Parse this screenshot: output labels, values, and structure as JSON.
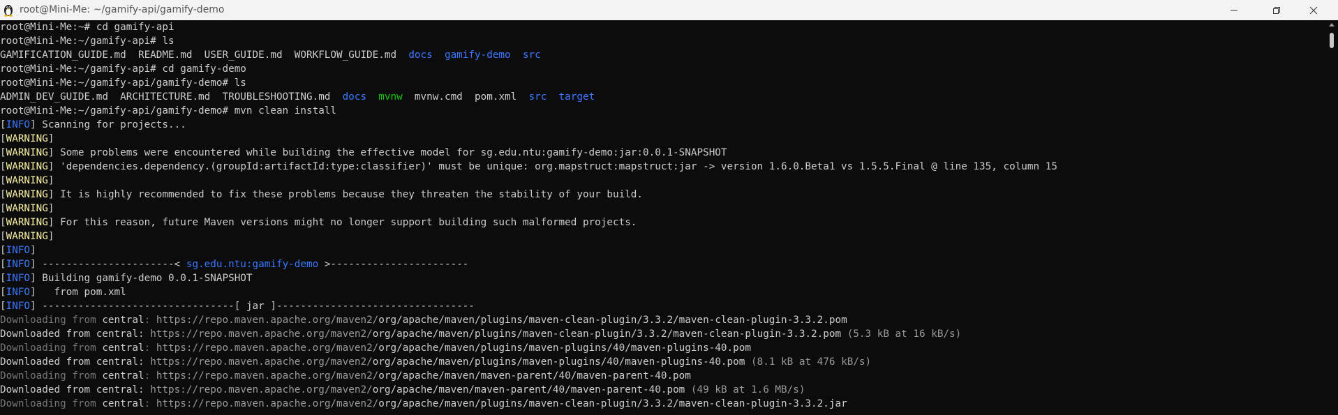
{
  "window": {
    "title": "root@Mini-Me: ~/gamify-api/gamify-demo"
  },
  "lines": [
    {
      "segments": [
        {
          "t": "root@Mini-Me:~# cd gamify-api",
          "c": ""
        }
      ]
    },
    {
      "segments": [
        {
          "t": "root@Mini-Me:~/gamify-api# ls",
          "c": ""
        }
      ]
    },
    {
      "segments": [
        {
          "t": "GAMIFICATION_GUIDE.md  README.md  USER_GUIDE.md  WORKFLOW_GUIDE.md  ",
          "c": ""
        },
        {
          "t": "docs",
          "c": "c-blue"
        },
        {
          "t": "  ",
          "c": ""
        },
        {
          "t": "gamify-demo",
          "c": "c-blue"
        },
        {
          "t": "  ",
          "c": ""
        },
        {
          "t": "src",
          "c": "c-blue"
        }
      ]
    },
    {
      "segments": [
        {
          "t": "root@Mini-Me:~/gamify-api# cd gamify-demo",
          "c": ""
        }
      ]
    },
    {
      "segments": [
        {
          "t": "root@Mini-Me:~/gamify-api/gamify-demo# ls",
          "c": ""
        }
      ]
    },
    {
      "segments": [
        {
          "t": "ADMIN_DEV_GUIDE.md  ARCHITECTURE.md  TROUBLESHOOTING.md  ",
          "c": ""
        },
        {
          "t": "docs",
          "c": "c-blue"
        },
        {
          "t": "  ",
          "c": ""
        },
        {
          "t": "mvnw",
          "c": "c-green"
        },
        {
          "t": "  mvnw.cmd  pom.xml  ",
          "c": ""
        },
        {
          "t": "src",
          "c": "c-blue"
        },
        {
          "t": "  ",
          "c": ""
        },
        {
          "t": "target",
          "c": "c-blue"
        }
      ]
    },
    {
      "segments": [
        {
          "t": "root@Mini-Me:~/gamify-api/gamify-demo# mvn clean install",
          "c": ""
        }
      ]
    },
    {
      "segments": [
        {
          "t": "[",
          "c": ""
        },
        {
          "t": "INFO",
          "c": "c-blue"
        },
        {
          "t": "] Scanning for projects...",
          "c": ""
        }
      ]
    },
    {
      "segments": [
        {
          "t": "[",
          "c": ""
        },
        {
          "t": "WARNING",
          "c": "c-yellow"
        },
        {
          "t": "]",
          "c": ""
        }
      ]
    },
    {
      "segments": [
        {
          "t": "[",
          "c": ""
        },
        {
          "t": "WARNING",
          "c": "c-yellow"
        },
        {
          "t": "] Some problems were encountered while building the effective model for sg.edu.ntu:gamify-demo:jar:0.0.1-SNAPSHOT",
          "c": ""
        }
      ]
    },
    {
      "segments": [
        {
          "t": "[",
          "c": ""
        },
        {
          "t": "WARNING",
          "c": "c-yellow"
        },
        {
          "t": "] 'dependencies.dependency.(groupId:artifactId:type:classifier)' must be unique: org.mapstruct:mapstruct:jar -> version 1.6.0.Beta1 vs 1.5.5.Final @ line 135, column 15",
          "c": ""
        }
      ]
    },
    {
      "segments": [
        {
          "t": "[",
          "c": ""
        },
        {
          "t": "WARNING",
          "c": "c-yellow"
        },
        {
          "t": "]",
          "c": ""
        }
      ]
    },
    {
      "segments": [
        {
          "t": "[",
          "c": ""
        },
        {
          "t": "WARNING",
          "c": "c-yellow"
        },
        {
          "t": "] It is highly recommended to fix these problems because they threaten the stability of your build.",
          "c": ""
        }
      ]
    },
    {
      "segments": [
        {
          "t": "[",
          "c": ""
        },
        {
          "t": "WARNING",
          "c": "c-yellow"
        },
        {
          "t": "]",
          "c": ""
        }
      ]
    },
    {
      "segments": [
        {
          "t": "[",
          "c": ""
        },
        {
          "t": "WARNING",
          "c": "c-yellow"
        },
        {
          "t": "] For this reason, future Maven versions might no longer support building such malformed projects.",
          "c": ""
        }
      ]
    },
    {
      "segments": [
        {
          "t": "[",
          "c": ""
        },
        {
          "t": "WARNING",
          "c": "c-yellow"
        },
        {
          "t": "]",
          "c": ""
        }
      ]
    },
    {
      "segments": [
        {
          "t": "[",
          "c": ""
        },
        {
          "t": "INFO",
          "c": "c-blue"
        },
        {
          "t": "]",
          "c": ""
        }
      ]
    },
    {
      "segments": [
        {
          "t": "[",
          "c": ""
        },
        {
          "t": "INFO",
          "c": "c-blue"
        },
        {
          "t": "] ----------------------< ",
          "c": ""
        },
        {
          "t": "sg.edu.ntu:gamify-demo",
          "c": "c-blue"
        },
        {
          "t": " >-----------------------",
          "c": ""
        }
      ]
    },
    {
      "segments": [
        {
          "t": "[",
          "c": ""
        },
        {
          "t": "INFO",
          "c": "c-blue"
        },
        {
          "t": "] Building gamify-demo 0.0.1-SNAPSHOT",
          "c": ""
        }
      ]
    },
    {
      "segments": [
        {
          "t": "[",
          "c": ""
        },
        {
          "t": "INFO",
          "c": "c-blue"
        },
        {
          "t": "]   from pom.xml",
          "c": ""
        }
      ]
    },
    {
      "segments": [
        {
          "t": "[",
          "c": ""
        },
        {
          "t": "INFO",
          "c": "c-blue"
        },
        {
          "t": "] --------------------------------[ jar ]---------------------------------",
          "c": ""
        }
      ]
    },
    {
      "segments": [
        {
          "t": "Downloading from ",
          "c": "c-gray"
        },
        {
          "t": "central",
          "c": ""
        },
        {
          "t": ": ",
          "c": "c-gray"
        },
        {
          "t": "https://repo.maven.apache.org/maven2/",
          "c": "c-url"
        },
        {
          "t": "org/apache/maven/plugins/maven-clean-plugin/3.3.2/maven-clean-plugin-3.3.2.pom",
          "c": ""
        }
      ]
    },
    {
      "segments": [
        {
          "t": "Downloaded from ",
          "c": ""
        },
        {
          "t": "central",
          "c": ""
        },
        {
          "t": ": ",
          "c": ""
        },
        {
          "t": "https://repo.maven.apache.org/maven2/",
          "c": "c-url"
        },
        {
          "t": "org/apache/maven/plugins/maven-clean-plugin/3.3.2/maven-clean-plugin-3.3.2.pom",
          "c": ""
        },
        {
          "t": " (5.3 kB at 16 kB/s)",
          "c": "c-url"
        }
      ]
    },
    {
      "segments": [
        {
          "t": "Downloading from ",
          "c": "c-gray"
        },
        {
          "t": "central",
          "c": ""
        },
        {
          "t": ": ",
          "c": "c-gray"
        },
        {
          "t": "https://repo.maven.apache.org/maven2/",
          "c": "c-url"
        },
        {
          "t": "org/apache/maven/plugins/maven-plugins/40/maven-plugins-40.pom",
          "c": ""
        }
      ]
    },
    {
      "segments": [
        {
          "t": "Downloaded from ",
          "c": ""
        },
        {
          "t": "central",
          "c": ""
        },
        {
          "t": ": ",
          "c": ""
        },
        {
          "t": "https://repo.maven.apache.org/maven2/",
          "c": "c-url"
        },
        {
          "t": "org/apache/maven/plugins/maven-plugins/40/maven-plugins-40.pom",
          "c": ""
        },
        {
          "t": " (8.1 kB at 476 kB/s)",
          "c": "c-url"
        }
      ]
    },
    {
      "segments": [
        {
          "t": "Downloading from ",
          "c": "c-gray"
        },
        {
          "t": "central",
          "c": ""
        },
        {
          "t": ": ",
          "c": "c-gray"
        },
        {
          "t": "https://repo.maven.apache.org/maven2/",
          "c": "c-url"
        },
        {
          "t": "org/apache/maven/maven-parent/40/maven-parent-40.pom",
          "c": ""
        }
      ]
    },
    {
      "segments": [
        {
          "t": "Downloaded from ",
          "c": ""
        },
        {
          "t": "central",
          "c": ""
        },
        {
          "t": ": ",
          "c": ""
        },
        {
          "t": "https://repo.maven.apache.org/maven2/",
          "c": "c-url"
        },
        {
          "t": "org/apache/maven/maven-parent/40/maven-parent-40.pom",
          "c": ""
        },
        {
          "t": " (49 kB at 1.6 MB/s)",
          "c": "c-url"
        }
      ]
    },
    {
      "segments": [
        {
          "t": "Downloading from ",
          "c": "c-gray"
        },
        {
          "t": "central",
          "c": ""
        },
        {
          "t": ": ",
          "c": "c-gray"
        },
        {
          "t": "https://repo.maven.apache.org/maven2/",
          "c": "c-url"
        },
        {
          "t": "org/apache/maven/plugins/maven-clean-plugin/3.3.2/maven-clean-plugin-3.3.2.jar",
          "c": ""
        }
      ]
    }
  ]
}
